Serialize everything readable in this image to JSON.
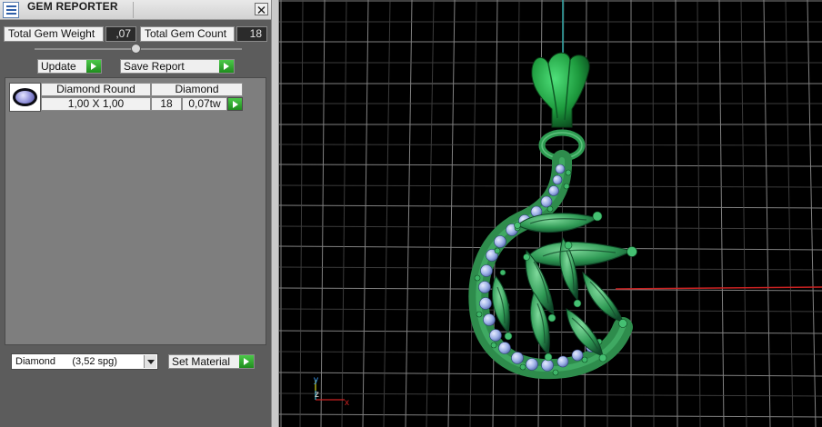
{
  "window": {
    "title": "GEM REPORTER"
  },
  "summary": {
    "total_weight_label": "Total Gem Weight",
    "total_weight_value": ",07",
    "total_count_label": "Total Gem Count",
    "total_count_value": "18"
  },
  "actions": {
    "update_label": "Update",
    "save_report_label": "Save Report"
  },
  "gems": [
    {
      "name": "Diamond Round",
      "material": "Diamond",
      "size": "1,00 X 1,00",
      "count": "18",
      "weight": "0,07tw"
    }
  ],
  "material_select": {
    "value": "Diamond      (3,52 spg)"
  },
  "set_material_label": "Set Material",
  "axis": {
    "y": "y",
    "z": "z",
    "x": "x"
  },
  "colors": {
    "panel": "#5c5c5c",
    "go_button": "#2ea82c",
    "metal_green": "#2e9c52",
    "gem_blue": "#9fb4e8",
    "axis_red": "#cc2222",
    "axis_cyan": "#33aaaa"
  },
  "icons": [
    "app-icon",
    "close-icon",
    "gem-thumbnail",
    "dropdown-arrow-icon",
    "play-arrow-icon"
  ]
}
